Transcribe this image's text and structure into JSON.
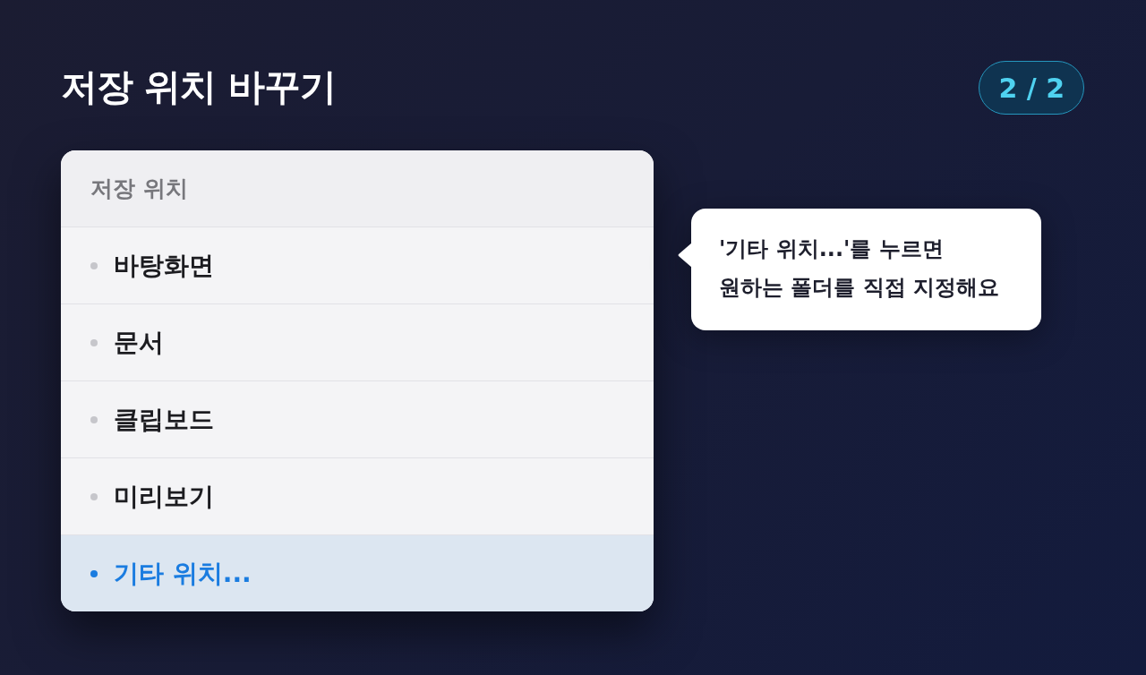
{
  "title": "저장 위치 바꾸기",
  "page_indicator": "2 / 2",
  "menu": {
    "header": "저장 위치",
    "items": [
      {
        "label": "바탕화면",
        "selected": false
      },
      {
        "label": "문서",
        "selected": false
      },
      {
        "label": "클립보드",
        "selected": false
      },
      {
        "label": "미리보기",
        "selected": false
      },
      {
        "label": "기타 위치...",
        "selected": true
      }
    ]
  },
  "callout": {
    "text": "'기타 위치...'를 누르면\n원하는 폴더를 직접 지정해요"
  }
}
